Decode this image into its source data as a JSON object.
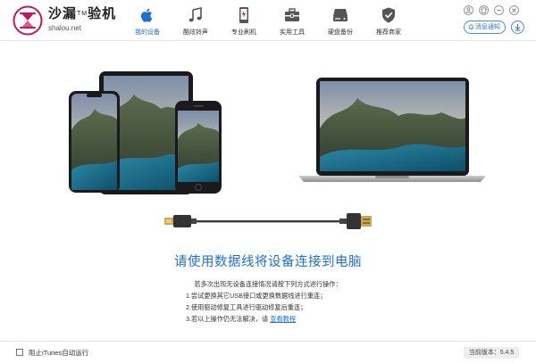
{
  "app": {
    "brand_name": "沙漏",
    "brand_tm": "TM",
    "brand_suffix": "验机",
    "url": "shalou.net",
    "accent": "#1f6fd1",
    "logo_color": "#c2185b"
  },
  "nav": [
    {
      "label": "我的设备",
      "icon": "apple-icon",
      "active": true
    },
    {
      "label": "酷炫铃声",
      "icon": "music-note-icon",
      "active": false
    },
    {
      "label": "专业刷机",
      "icon": "phone-flash-icon",
      "active": false
    },
    {
      "label": "实用工具",
      "icon": "toolbox-icon",
      "active": false
    },
    {
      "label": "硬盘备份",
      "icon": "hard-drive-icon",
      "active": false
    },
    {
      "label": "推荐商家",
      "icon": "shield-check-icon",
      "active": false
    }
  ],
  "notify": {
    "label": "消息通知"
  },
  "main": {
    "title": "请使用数据线将设备连接到电脑",
    "tips_title": "若多次出现无设备连接情况请按下列方式进行操作：",
    "tip1": "1.尝试更换其它USB接口或更换数据线进行重连；",
    "tip2": "2.使用驱动修复工具进行驱动修复后重连；",
    "tip3": "3.若以上操作仍无法解决，请",
    "tutorial_link": "查看教程"
  },
  "footer": {
    "itunes_label": "阻止iTunes自动运行",
    "itunes_checked": false,
    "version_label": "当前版本：5.4.5"
  }
}
